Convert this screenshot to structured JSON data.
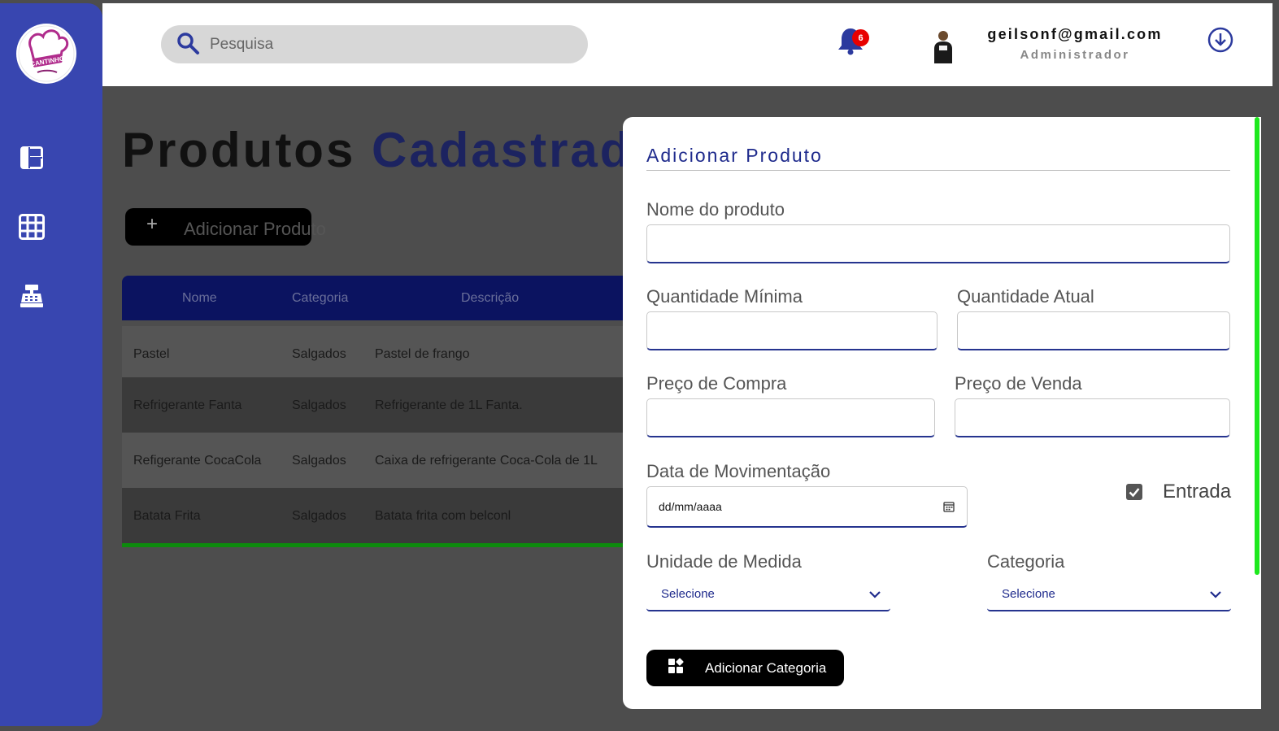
{
  "brand": {
    "logo_text": "CANTINHO"
  },
  "header": {
    "search_placeholder": "Pesquisa",
    "notification_count": "6",
    "user_email": "geilsonf@gmail.com",
    "user_role": "Administrador"
  },
  "main": {
    "title_primary": "Produtos",
    "title_accent": "Cadastrad",
    "add_button_label": "Adicionar Produto",
    "table": {
      "headers": [
        "Nome",
        "Categoria",
        "Descrição"
      ],
      "rows": [
        [
          "Pastel",
          "Salgados",
          "Pastel de frango"
        ],
        [
          "Refrigerante Fanta",
          "Salgados",
          "Refrigerante de 1L Fanta."
        ],
        [
          "Refigerante CocaCola",
          "Salgados",
          "Caixa de refrigerante Coca-Cola de 1L"
        ],
        [
          "Batata Frita",
          "Salgados",
          "Batata frita com belconl"
        ]
      ]
    }
  },
  "modal": {
    "title": "Adicionar Produto",
    "name_label": "Nome do produto",
    "min_qty_label": "Quantidade Mínima",
    "cur_qty_label": "Quantidade Atual",
    "buy_price_label": "Preço de Compra",
    "sell_price_label": "Preço de Venda",
    "date_label": "Data de Movimentação",
    "date_placeholder": "dd/mm/aaaa",
    "entry_label": "Entrada",
    "entry_checked": true,
    "unit_label": "Unidade de Medida",
    "unit_value": "Selecione",
    "category_label": "Categoria",
    "category_value": "Selecione",
    "add_category_label": "Adicionar Categoria"
  },
  "colors": {
    "sidebar": "#3846b0",
    "accent_blue": "#1e2a8c",
    "badge": "#e80000",
    "scroll_green": "#1ee81e"
  }
}
